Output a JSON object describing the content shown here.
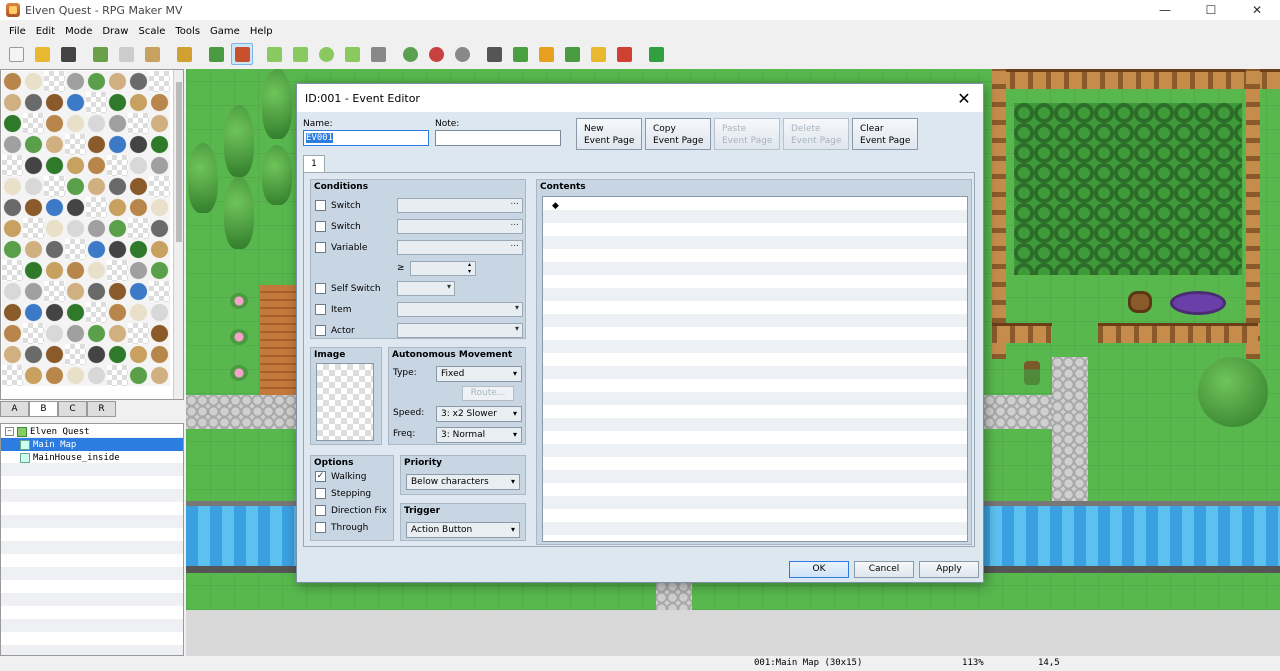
{
  "window": {
    "title": "Elven Quest - RPG Maker MV",
    "minimize": "—",
    "maximize": "☐",
    "close": "✕"
  },
  "menu": [
    "File",
    "Edit",
    "Mode",
    "Draw",
    "Scale",
    "Tools",
    "Game",
    "Help"
  ],
  "toolbar": [
    {
      "icon": "new-icon",
      "color": "#f4f4f4"
    },
    {
      "icon": "open-icon",
      "color": "#e8b830"
    },
    {
      "icon": "save-icon",
      "color": "#444444"
    },
    {
      "icon": "cut-icon",
      "color": "#6aa04a"
    },
    {
      "icon": "copy-icon",
      "color": "#cccccc"
    },
    {
      "icon": "paste-icon",
      "color": "#c8a060"
    },
    {
      "icon": "undo-icon",
      "color": "#d0a030"
    },
    {
      "icon": "map-mode-icon",
      "color": "#4a9a42"
    },
    {
      "icon": "event-mode-icon",
      "color": "#c8502c"
    },
    {
      "icon": "pencil-icon",
      "color": "#8ac860"
    },
    {
      "icon": "rectangle-icon",
      "color": "#8ac860"
    },
    {
      "icon": "ellipse-icon",
      "color": "#8ac860"
    },
    {
      "icon": "fill-icon",
      "color": "#8ac860"
    },
    {
      "icon": "shadow-pen-icon",
      "color": "#888888"
    },
    {
      "icon": "zoom-in-icon",
      "color": "#5aa050"
    },
    {
      "icon": "zoom-out-icon",
      "color": "#c84040"
    },
    {
      "icon": "actual-size-icon",
      "color": "#888888"
    },
    {
      "icon": "database-icon",
      "color": "#555555"
    },
    {
      "icon": "plugin-icon",
      "color": "#4aa040"
    },
    {
      "icon": "sound-test-icon",
      "color": "#e8a020"
    },
    {
      "icon": "event-search-icon",
      "color": "#4a9a42"
    },
    {
      "icon": "resource-manager-icon",
      "color": "#e8b830"
    },
    {
      "icon": "character-generator-icon",
      "color": "#d04030"
    },
    {
      "icon": "playtest-icon",
      "color": "#30a040"
    }
  ],
  "tileset_tabs": [
    "A",
    "B",
    "C",
    "R"
  ],
  "selected_tab": "B",
  "map_tree": [
    {
      "label": "Elven Quest",
      "level": 0
    },
    {
      "label": "Main Map",
      "level": 1,
      "selected": true
    },
    {
      "label": "MainHouse_inside",
      "level": 1
    }
  ],
  "status": {
    "map": "001:Main Map (30x15)",
    "zoom": "113%",
    "coords": "14,5"
  },
  "dialog": {
    "title": "ID:001 - Event Editor",
    "name_label": "Name:",
    "name_value": "EV001",
    "note_label": "Note:",
    "note_value": "",
    "page_buttons": [
      {
        "line1": "New",
        "line2": "Event Page",
        "enabled": true
      },
      {
        "line1": "Copy",
        "line2": "Event Page",
        "enabled": true
      },
      {
        "line1": "Paste",
        "line2": "Event Page",
        "enabled": false
      },
      {
        "line1": "Delete",
        "line2": "Event Page",
        "enabled": false
      },
      {
        "line1": "Clear",
        "line2": "Event Page",
        "enabled": true
      }
    ],
    "page_tab": "1",
    "conditions": {
      "title": "Conditions",
      "switch1": "Switch",
      "switch2": "Switch",
      "variable": "Variable",
      "gte": "≥",
      "self_switch": "Self Switch",
      "item": "Item",
      "actor": "Actor"
    },
    "image": {
      "title": "Image"
    },
    "movement": {
      "title": "Autonomous Movement",
      "type_label": "Type:",
      "type_value": "Fixed",
      "route": "Route...",
      "speed_label": "Speed:",
      "speed_value": "3: x2 Slower",
      "freq_label": "Freq:",
      "freq_value": "3: Normal"
    },
    "options": {
      "title": "Options",
      "walking": "Walking",
      "stepping": "Stepping",
      "direction_fix": "Direction Fix",
      "through": "Through",
      "checked": {
        "walking": true,
        "stepping": false,
        "direction_fix": false,
        "through": false
      }
    },
    "priority": {
      "title": "Priority",
      "value": "Below characters"
    },
    "trigger": {
      "title": "Trigger",
      "value": "Action Button"
    },
    "contents": {
      "title": "Contents",
      "first_line": "◆"
    },
    "buttons": {
      "ok": "OK",
      "cancel": "Cancel",
      "apply": "Apply"
    }
  }
}
